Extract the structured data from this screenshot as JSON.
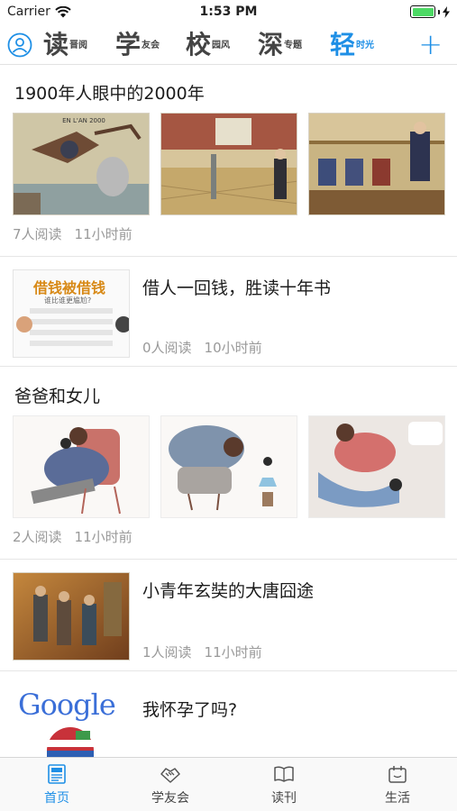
{
  "status_bar": {
    "carrier": "Carrier",
    "time": "1:53 PM"
  },
  "channels": [
    {
      "big": "读",
      "small": "晋阅",
      "active": false
    },
    {
      "big": "学",
      "small": "友会",
      "active": false
    },
    {
      "big": "校",
      "small": "园风",
      "active": false
    },
    {
      "big": "深",
      "small": "专题",
      "active": false
    },
    {
      "big": "轻",
      "small": "时光",
      "active": true
    }
  ],
  "feed": [
    {
      "title": "1900年人眼中的2000年",
      "reads": "7人阅读",
      "time": "11小时前",
      "image_label": "EN L'AN 2000"
    },
    {
      "title": "借人一回钱，胜读十年书",
      "reads": "0人阅读",
      "time": "10小时前",
      "image_label": "借钱被借钱",
      "image_sub": "谁比谁更尴尬?"
    },
    {
      "title": "爸爸和女儿",
      "reads": "2人阅读",
      "time": "11小时前"
    },
    {
      "title": "小青年玄奘的大唐囧途",
      "reads": "1人阅读",
      "time": "11小时前"
    },
    {
      "title": "我怀孕了吗?",
      "image_label": "Google"
    }
  ],
  "tabbar": [
    {
      "label": "首页",
      "icon": "news-icon",
      "active": true
    },
    {
      "label": "学友会",
      "icon": "handshake-icon",
      "active": false
    },
    {
      "label": "读刊",
      "icon": "book-icon",
      "active": false
    },
    {
      "label": "生活",
      "icon": "life-icon",
      "active": false
    }
  ]
}
